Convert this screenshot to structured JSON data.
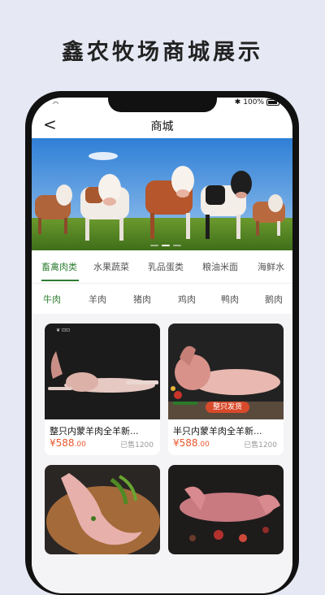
{
  "headline": "鑫农牧场商城展示",
  "status": {
    "battery": "100%"
  },
  "navbar": {
    "title": "商城",
    "back": "<"
  },
  "categories": [
    {
      "label": "畜禽肉类",
      "active": true
    },
    {
      "label": "水果蔬菜",
      "active": false
    },
    {
      "label": "乳品蛋类",
      "active": false
    },
    {
      "label": "粮油米面",
      "active": false
    },
    {
      "label": "海鲜水",
      "active": false
    }
  ],
  "subcategories": [
    {
      "label": "牛肉",
      "active": true
    },
    {
      "label": "羊肉",
      "active": false
    },
    {
      "label": "猪肉",
      "active": false
    },
    {
      "label": "鸡肉",
      "active": false
    },
    {
      "label": "鸭肉",
      "active": false
    },
    {
      "label": "鹅肉",
      "active": false
    }
  ],
  "products": [
    {
      "name": "整只内蒙羊肉全羊新...",
      "price_main": "¥588",
      "price_cents": ".00",
      "sold": "已售1200",
      "badge": ""
    },
    {
      "name": "半只内蒙羊肉全羊新...",
      "price_main": "¥588",
      "price_cents": ".00",
      "sold": "已售1200",
      "badge": "整只发货"
    }
  ],
  "colors": {
    "accent": "#2e7d32",
    "price": "#e8572d",
    "badge": "#d84a2b"
  }
}
